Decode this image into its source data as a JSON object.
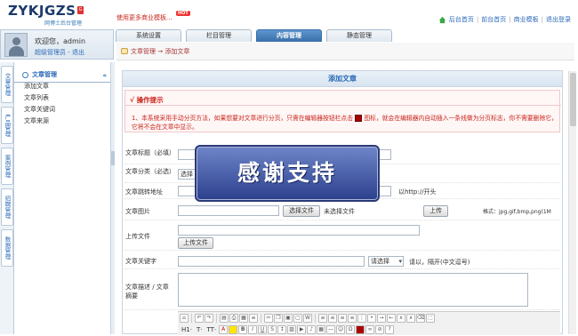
{
  "header": {
    "logo": "ZYKJGZS",
    "logo_badge": "G",
    "logo_sub": "网博士后台管理",
    "promo": "使用更多商业模板...",
    "hot": "HOT",
    "links": [
      "后台首页",
      "前台首页",
      "商业模板",
      "退出登录"
    ]
  },
  "user": {
    "welcome": "欢迎您，admin",
    "role": "超级管理员 - 退出"
  },
  "tabs": [
    "系统设置",
    "栏目管理",
    "内容管理",
    "静态管理"
  ],
  "active_tab": 2,
  "vtabs": [
    "文章管理",
    "产品管理",
    "案例管理",
    "招聘管理",
    "数据管理"
  ],
  "menu": {
    "title": "文章管理",
    "collapse": "«",
    "items": [
      "添加文章",
      "文章列表",
      "文章关键词",
      "文章来源"
    ]
  },
  "breadcrumb": "文章管理 → 添加文章",
  "panel": {
    "title": "添加文章",
    "tips_title": "√ 操作提示",
    "tips_text_a": "1、本系统采用手动分页方法，如果想要对文章进行分页，只需在编辑器按钮栏点击",
    "tips_text_b": "图标，就会在编辑器内自动插入一条线做为分页标志，你不需要删除它，它将不会在文章中显示。"
  },
  "form": {
    "title_label": "文章标题（必填）",
    "category_label": "文章分类（必选）",
    "category_select": "选择",
    "redirect_label": "文章跳转地址",
    "redirect_hint": "以http://开头",
    "image_label": "文章图片",
    "choose_file": "选择文件",
    "no_file": "未选择文件",
    "upload": "上传",
    "image_format": "格式：jpg,gif,bmp,png(1M",
    "upload_file_label": "上传文件",
    "upload_file_btn": "上传文件",
    "keywords_label": "文章关键字",
    "keywords_select": "请选择",
    "keywords_hint": "请以，隔开(中文逗号)",
    "summary_label": "文章描述 / 文章摘要",
    "font_label": "H1·",
    "font_label2": "T·",
    "font_size": "TT·",
    "font_letter": "A",
    "bold": "B",
    "italic": "I",
    "underline": "U"
  },
  "banner": "感谢支持"
}
